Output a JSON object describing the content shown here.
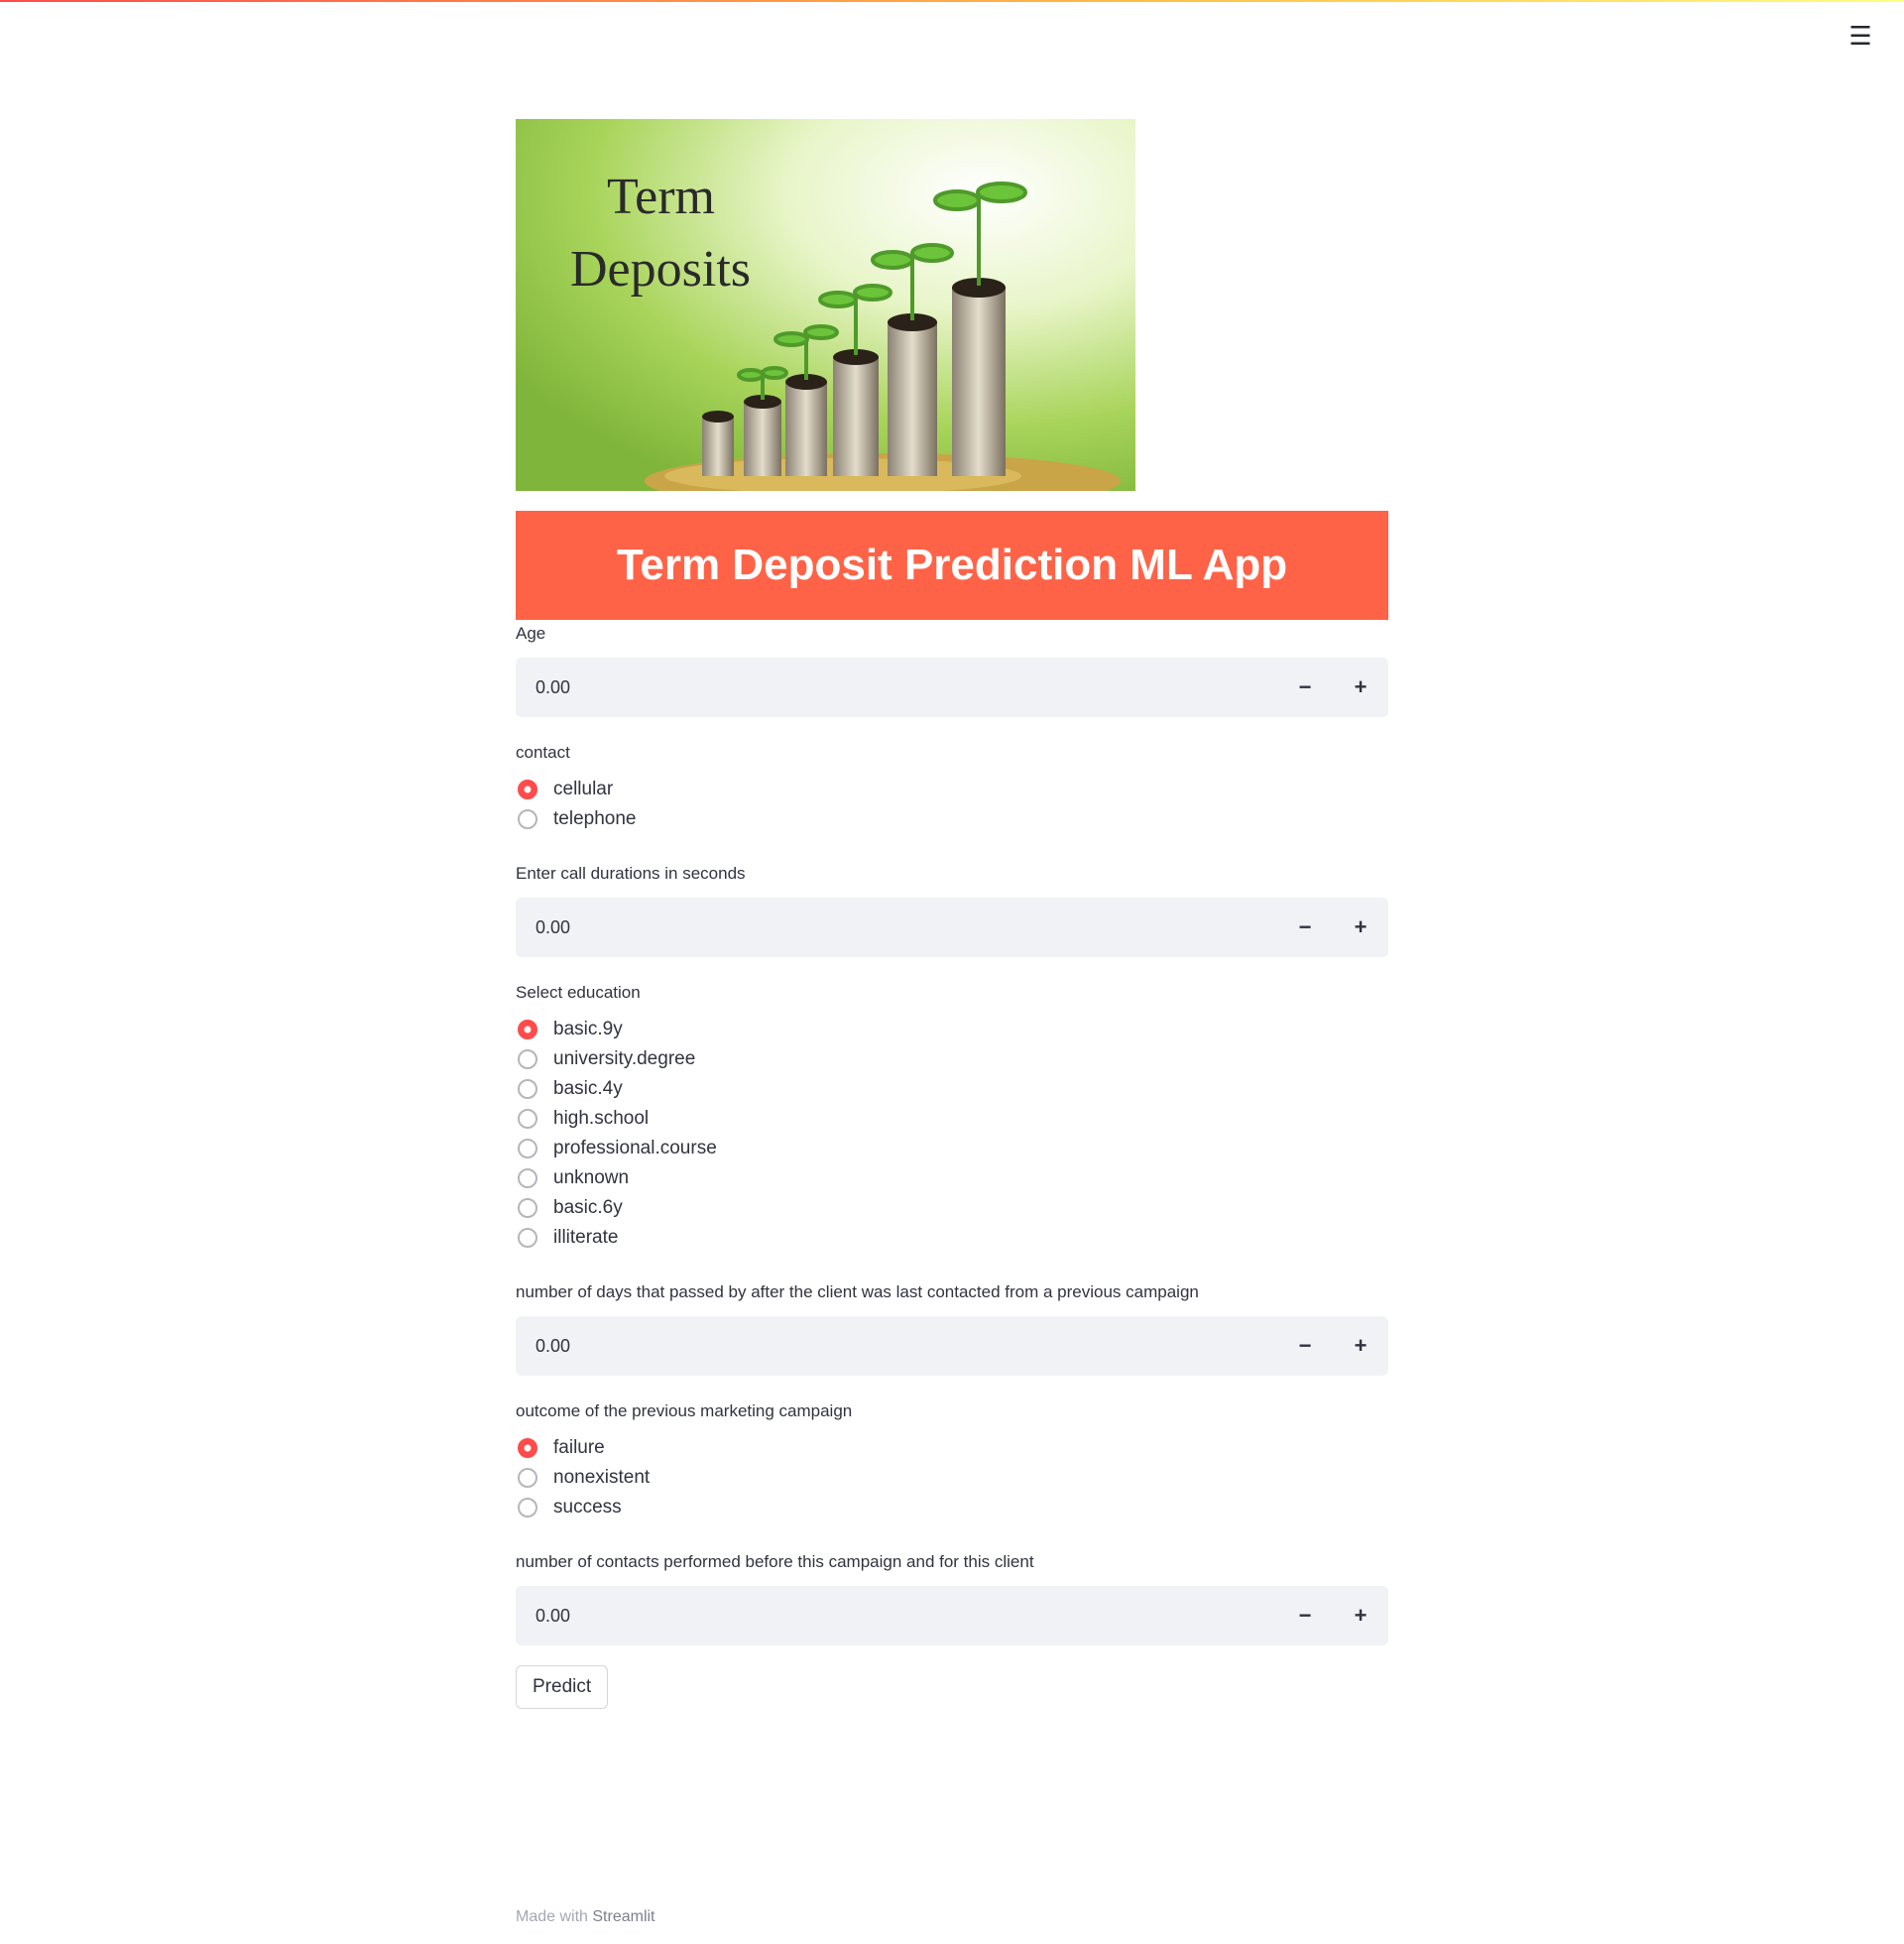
{
  "menu": {
    "icon": "hamburger-menu-icon"
  },
  "hero_image": {
    "lines": [
      "Term",
      "Deposits"
    ]
  },
  "title": "Term Deposit Prediction ML App",
  "fields": {
    "age": {
      "label": "Age",
      "value": "0.00"
    },
    "contact": {
      "label": "contact",
      "options": [
        "cellular",
        "telephone"
      ],
      "selected": "cellular"
    },
    "duration": {
      "label": "Enter call durations in seconds",
      "value": "0.00"
    },
    "education": {
      "label": "Select education",
      "options": [
        "basic.9y",
        "university.degree",
        "basic.4y",
        "high.school",
        "professional.course",
        "unknown",
        "basic.6y",
        "illiterate"
      ],
      "selected": "basic.9y"
    },
    "pdays": {
      "label": "number of days that passed by after the client was last contacted from a previous campaign",
      "value": "0.00"
    },
    "poutcome": {
      "label": "outcome of the previous marketing campaign",
      "options": [
        "failure",
        "nonexistent",
        "success"
      ],
      "selected": "failure"
    },
    "previous": {
      "label": "number of contacts performed before this campaign and for this client",
      "value": "0.00"
    }
  },
  "stepper": {
    "minus": "−",
    "plus": "+"
  },
  "predict_label": "Predict",
  "footer": {
    "prefix": "Made with ",
    "brand": "Streamlit"
  },
  "colors": {
    "banner": "#ff6347",
    "accent": "#ff4b4b",
    "input_bg": "#f0f2f6"
  }
}
